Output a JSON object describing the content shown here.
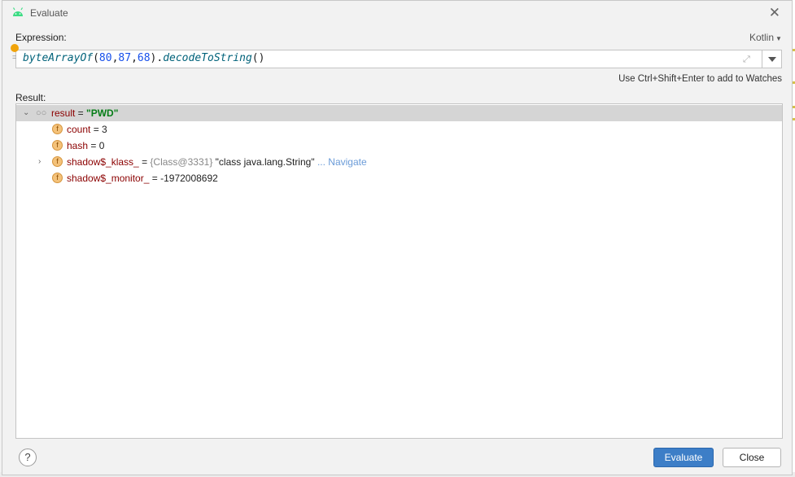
{
  "dialog": {
    "title": "Evaluate",
    "close_glyph": "✕"
  },
  "expression": {
    "label": "Expression:",
    "language": "Kotlin",
    "code_fn": "byteArrayOf",
    "code_args": [
      "80",
      "87",
      "68"
    ],
    "code_method": "decodeToString",
    "watch_hint": "Use Ctrl+Shift+Enter to add to Watches"
  },
  "result": {
    "label": "Result:",
    "root": {
      "name": "result",
      "eq": " = ",
      "value": "\"PWD\""
    },
    "fields": [
      {
        "name": "count",
        "eq": " = ",
        "value": "3"
      },
      {
        "name": "hash",
        "eq": " = ",
        "value": "0"
      },
      {
        "name": "shadow$_klass_",
        "eq": " = ",
        "type_ref": "{Class@3331}",
        "value": "\"class java.lang.String\"",
        "navigate": "... Navigate"
      },
      {
        "name": "shadow$_monitor_",
        "eq": " = ",
        "value": "-1972008692"
      }
    ]
  },
  "footer": {
    "help": "?",
    "evaluate": "Evaluate",
    "close": "Close"
  },
  "icons": {
    "title": "android-icon",
    "field": "field-icon",
    "watch": "glasses-icon"
  }
}
